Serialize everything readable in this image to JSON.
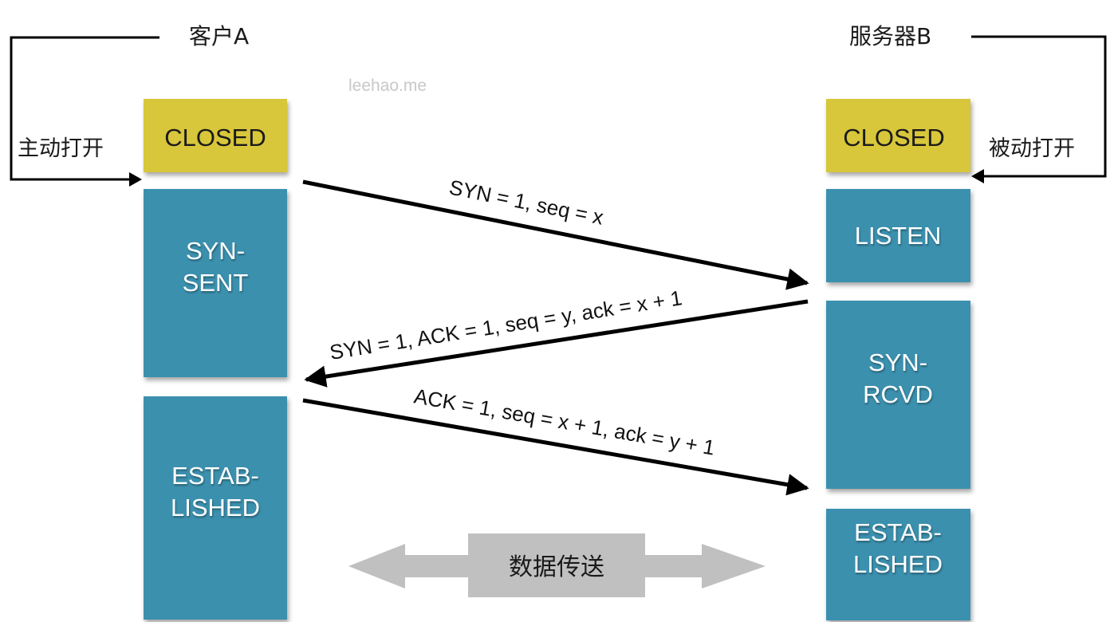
{
  "colors": {
    "closed": "#d8c63a",
    "state": "#3a90ae",
    "arrow": "#000000",
    "transfer": "#c0c0c0",
    "watermark": "#c8c8c8"
  },
  "watermark": "leehao.me",
  "client": {
    "title": "客户A",
    "open_label": "主动打开",
    "states": [
      "CLOSED",
      "SYN-\nSENT",
      "ESTAB-\nLISHED"
    ]
  },
  "server": {
    "title": "服务器B",
    "open_label": "被动打开",
    "states": [
      "CLOSED",
      "LISTEN",
      "SYN-\nRCVD",
      "ESTAB-\nLISHED"
    ]
  },
  "messages": [
    {
      "label": "SYN = 1, seq = x",
      "direction": "client-to-server"
    },
    {
      "label": "SYN = 1, ACK = 1, seq = y, ack = x + 1",
      "direction": "server-to-client"
    },
    {
      "label": "ACK = 1, seq = x + 1, ack = y + 1",
      "direction": "client-to-server"
    }
  ],
  "data_transfer": {
    "label": "数据传送",
    "direction": "bidirectional"
  }
}
